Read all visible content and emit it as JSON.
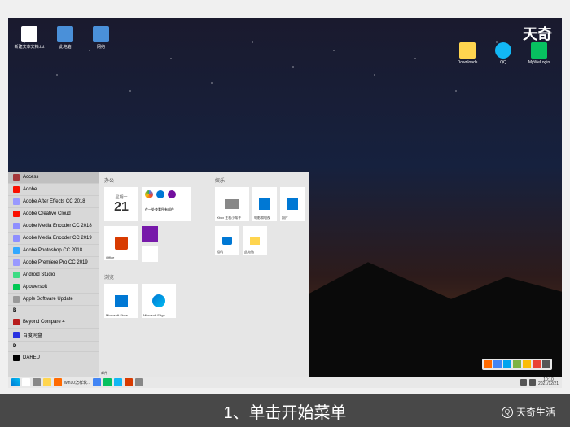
{
  "watermark": {
    "top": "天奇",
    "bottom": "天奇生活"
  },
  "caption": "1、单击开始菜单",
  "desktop_left": [
    {
      "label": "新建文本文档.txt"
    },
    {
      "label": "此电脑"
    },
    {
      "label": "网络"
    }
  ],
  "desktop_right": [
    {
      "label": "Downloads"
    },
    {
      "label": "QQ"
    },
    {
      "label": "MyWeLogin"
    }
  ],
  "startmenu": {
    "apps": [
      "Access",
      "Adobe",
      "Adobe After Effects CC 2018",
      "Adobe Creative Cloud",
      "Adobe Media Encoder CC 2018",
      "Adobe Media Encoder CC 2019",
      "Adobe Photoshop CC 2018",
      "Adobe Premiere Pro CC 2019",
      "Android Studio",
      "Apowersoft",
      "Apple Software Update",
      "B",
      "Beyond Compare 4",
      "百度网盘",
      "D",
      "DAREU"
    ],
    "sections": {
      "productivity": "办公",
      "entertainment": "娱乐",
      "browse": "浏览"
    },
    "calendar": {
      "day": "星期一",
      "date": "21"
    },
    "prod_label": "在一处查看所有邮件",
    "tiles": {
      "mail": "邮件",
      "office": "Office",
      "xbox": "Xbox 主机小帮手",
      "movies": "电影和电视",
      "photos": "照片",
      "camera": "相机",
      "pictures": "此电脑",
      "store": "Microsoft Store",
      "edge": "Microsoft Edge",
      "onenote": "OneNote"
    }
  },
  "taskbar": {
    "time": "10:10",
    "date": "2021/12/21"
  }
}
